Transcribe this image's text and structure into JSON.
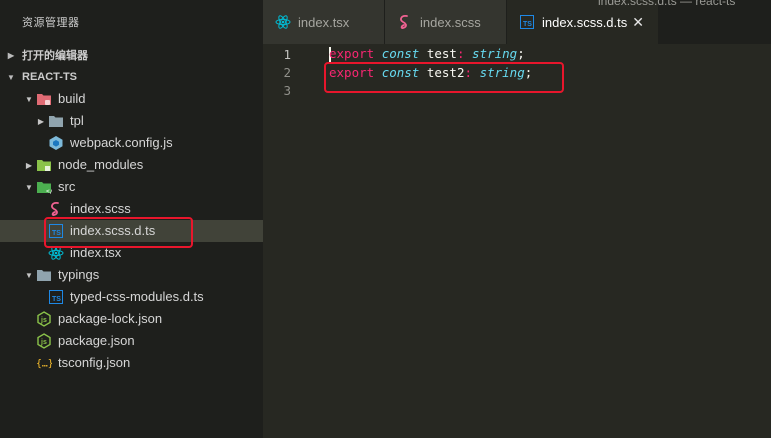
{
  "sidebar": {
    "title": "资源管理器",
    "open_editors": "打开的编辑器",
    "project": "REACT-TS",
    "tree": [
      {
        "label": "build",
        "depth": 1,
        "caret": "open",
        "icon": "folder-build-icon",
        "color": "#e06b74"
      },
      {
        "label": "tpl",
        "depth": 2,
        "caret": "closed",
        "icon": "folder-icon",
        "color": "#90a4ae"
      },
      {
        "label": "webpack.config.js",
        "depth": 2,
        "caret": "none",
        "icon": "webpack-icon",
        "color": "#8ed6fb"
      },
      {
        "label": "node_modules",
        "depth": 1,
        "caret": "closed",
        "icon": "folder-node-icon",
        "color": "#8bc34a"
      },
      {
        "label": "src",
        "depth": 1,
        "caret": "open",
        "icon": "folder-src-icon",
        "color": "#4caf50"
      },
      {
        "label": "index.scss",
        "depth": 2,
        "caret": "none",
        "icon": "sass-icon",
        "color": "#f06292"
      },
      {
        "label": "index.scss.d.ts",
        "depth": 2,
        "caret": "none",
        "icon": "typescript-icon",
        "color": "#1e88e5",
        "selected": true
      },
      {
        "label": "index.tsx",
        "depth": 2,
        "caret": "none",
        "icon": "react-icon",
        "color": "#00bcd4"
      },
      {
        "label": "typings",
        "depth": 1,
        "caret": "open",
        "icon": "folder-typings-icon",
        "color": "#90a4ae"
      },
      {
        "label": "typed-css-modules.d.ts",
        "depth": 2,
        "caret": "none",
        "icon": "typescript-icon",
        "color": "#1e88e5"
      },
      {
        "label": "package-lock.json",
        "depth": 1,
        "caret": "none",
        "icon": "npm-icon",
        "color": "#8bc34a"
      },
      {
        "label": "package.json",
        "depth": 1,
        "caret": "none",
        "icon": "npm-icon",
        "color": "#8bc34a"
      },
      {
        "label": "tsconfig.json",
        "depth": 1,
        "caret": "none",
        "icon": "json-icon",
        "color": "#fbc02d"
      }
    ]
  },
  "titlebar_peek": "index.scss.d.ts — react-ts",
  "tabs": [
    {
      "label": "index.tsx",
      "icon": "react-icon",
      "active": false
    },
    {
      "label": "index.scss",
      "icon": "sass-icon",
      "active": false
    },
    {
      "label": "index.scss.d.ts",
      "icon": "typescript-icon",
      "active": true,
      "close": "✕"
    }
  ],
  "editor": {
    "lines": [
      {
        "number": "1",
        "tokens": [
          [
            "kw",
            "export"
          ],
          [
            "sp",
            " "
          ],
          [
            "st",
            "const"
          ],
          [
            "sp",
            " "
          ],
          [
            "id",
            "test"
          ],
          [
            "kw",
            ":"
          ],
          [
            "sp",
            " "
          ],
          [
            "st",
            "string"
          ],
          [
            "pu",
            ";"
          ]
        ]
      },
      {
        "number": "2",
        "tokens": [
          [
            "kw",
            "export"
          ],
          [
            "sp",
            " "
          ],
          [
            "st",
            "const"
          ],
          [
            "sp",
            " "
          ],
          [
            "id",
            "test2"
          ],
          [
            "kw",
            ":"
          ],
          [
            "sp",
            " "
          ],
          [
            "st",
            "string"
          ],
          [
            "pu",
            ";"
          ]
        ]
      },
      {
        "number": "3",
        "tokens": []
      }
    ]
  },
  "colors": {
    "sidebar_bg": "#1e1f1c",
    "editor_bg": "#272822",
    "highlight_border": "#e8162c",
    "keyword": "#f92672",
    "storage": "#66d9ef"
  }
}
